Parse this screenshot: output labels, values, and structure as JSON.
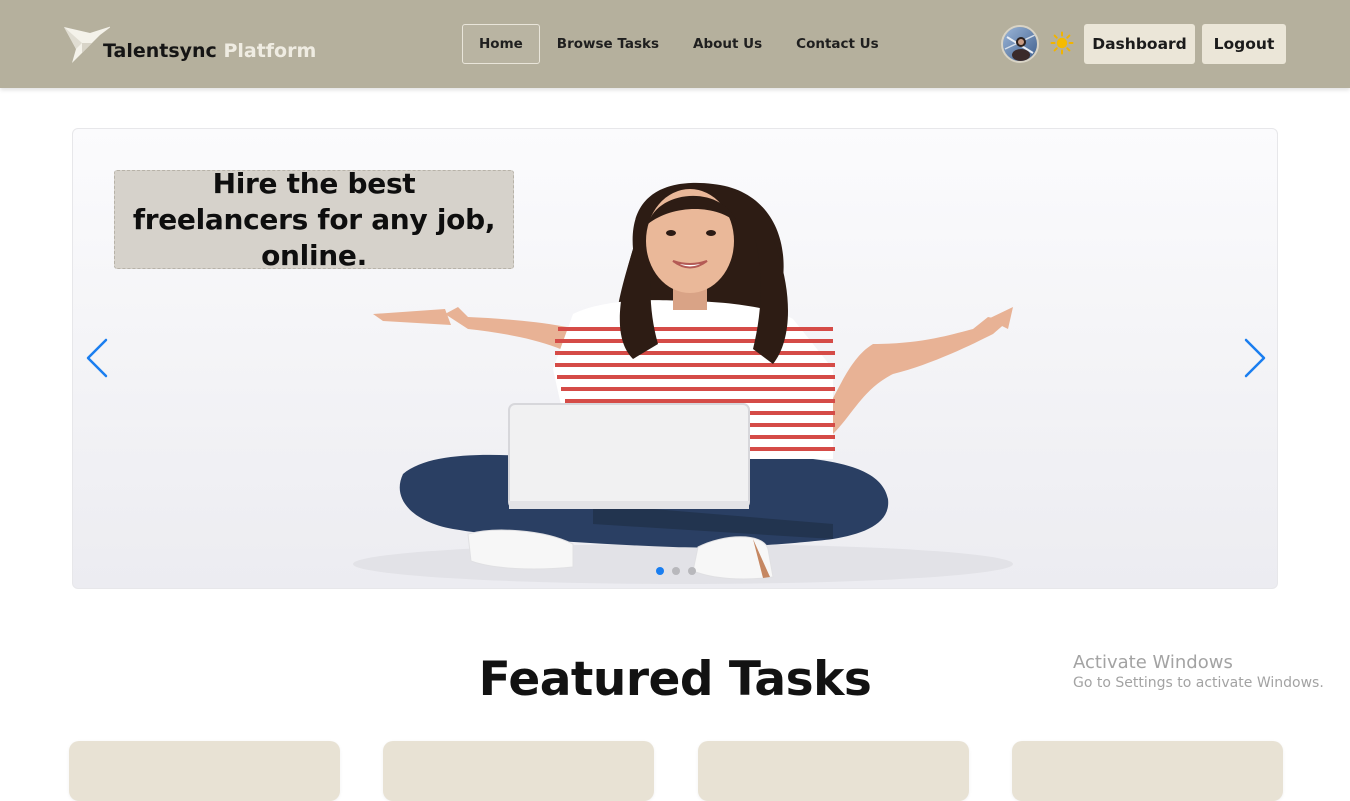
{
  "brand": {
    "name": "Talentsync",
    "suffix": "Platform"
  },
  "nav": {
    "links": [
      {
        "label": "Home",
        "active": true
      },
      {
        "label": "Browse Tasks",
        "active": false
      },
      {
        "label": "About Us",
        "active": false
      },
      {
        "label": "Contact Us",
        "active": false
      }
    ],
    "dashboard_label": "Dashboard",
    "logout_label": "Logout",
    "theme_icon": "sun-icon"
  },
  "hero": {
    "caption": "Hire the best freelancers for any job, online.",
    "slide_count": 3,
    "active_slide": 1
  },
  "featured": {
    "title": "Featured Tasks",
    "card_count": 4
  },
  "watermark": {
    "title": "Activate Windows",
    "subtitle": "Go to Settings to activate Windows."
  },
  "colors": {
    "navbar": "#b5b09d",
    "button": "#ebe6d8",
    "card": "#e8e2d4",
    "accent": "#1a7ef0",
    "caption_bg": "#d6d2cb"
  }
}
